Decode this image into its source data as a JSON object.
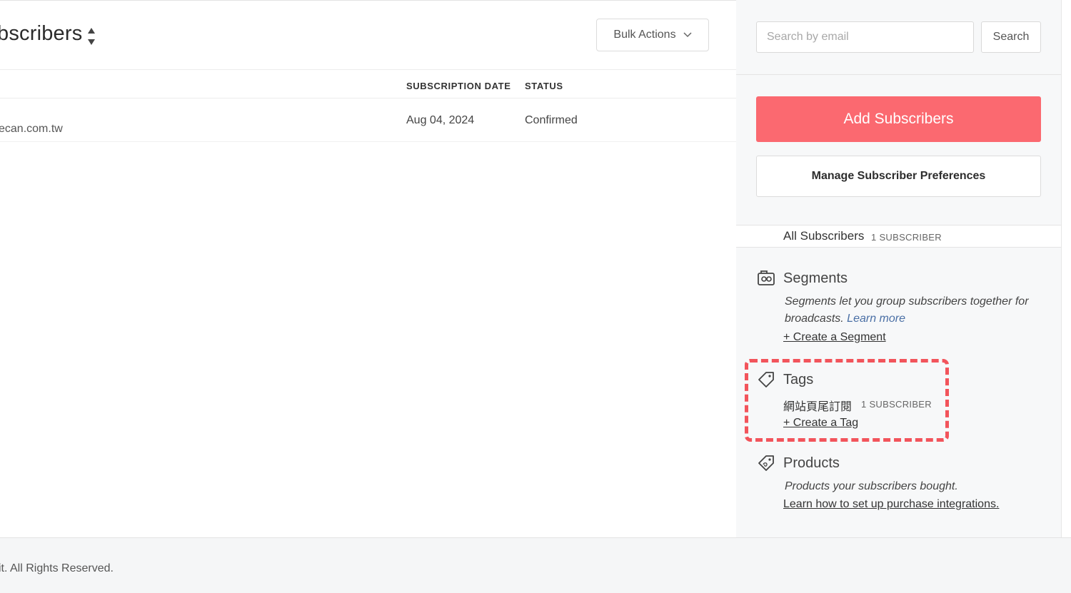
{
  "header": {
    "title": "bscribers",
    "bulk_actions_label": "Bulk Actions"
  },
  "table": {
    "columns": [
      "SUBSCRIPTION DATE",
      "STATUS"
    ],
    "rows": [
      {
        "email": "ecan.com.tw",
        "date": "Aug 04, 2024",
        "status": "Confirmed"
      }
    ]
  },
  "sidebar": {
    "search": {
      "placeholder": "Search by email",
      "button_label": "Search"
    },
    "add_subscribers_label": "Add Subscribers",
    "manage_preferences_label": "Manage Subscriber Preferences",
    "all_subscribers": {
      "label": "All Subscribers",
      "count": "1 SUBSCRIBER"
    },
    "segments": {
      "title": "Segments",
      "description": "Segments let you group subscribers together for broadcasts.",
      "learn_more": "Learn more",
      "create_label": "+ Create a Segment"
    },
    "tags": {
      "title": "Tags",
      "items": [
        {
          "name": "網站頁尾訂閱",
          "count": "1 SUBSCRIBER"
        }
      ],
      "create_label": "+ Create a Tag"
    },
    "products": {
      "title": "Products",
      "description": "Products your subscribers bought.",
      "link_label": "Learn how to set up purchase integrations."
    }
  },
  "footer": {
    "text": "it. All Rights Reserved."
  },
  "colors": {
    "accent": "#fb6970",
    "highlight": "#f2545b",
    "link": "#4a6fa5"
  }
}
